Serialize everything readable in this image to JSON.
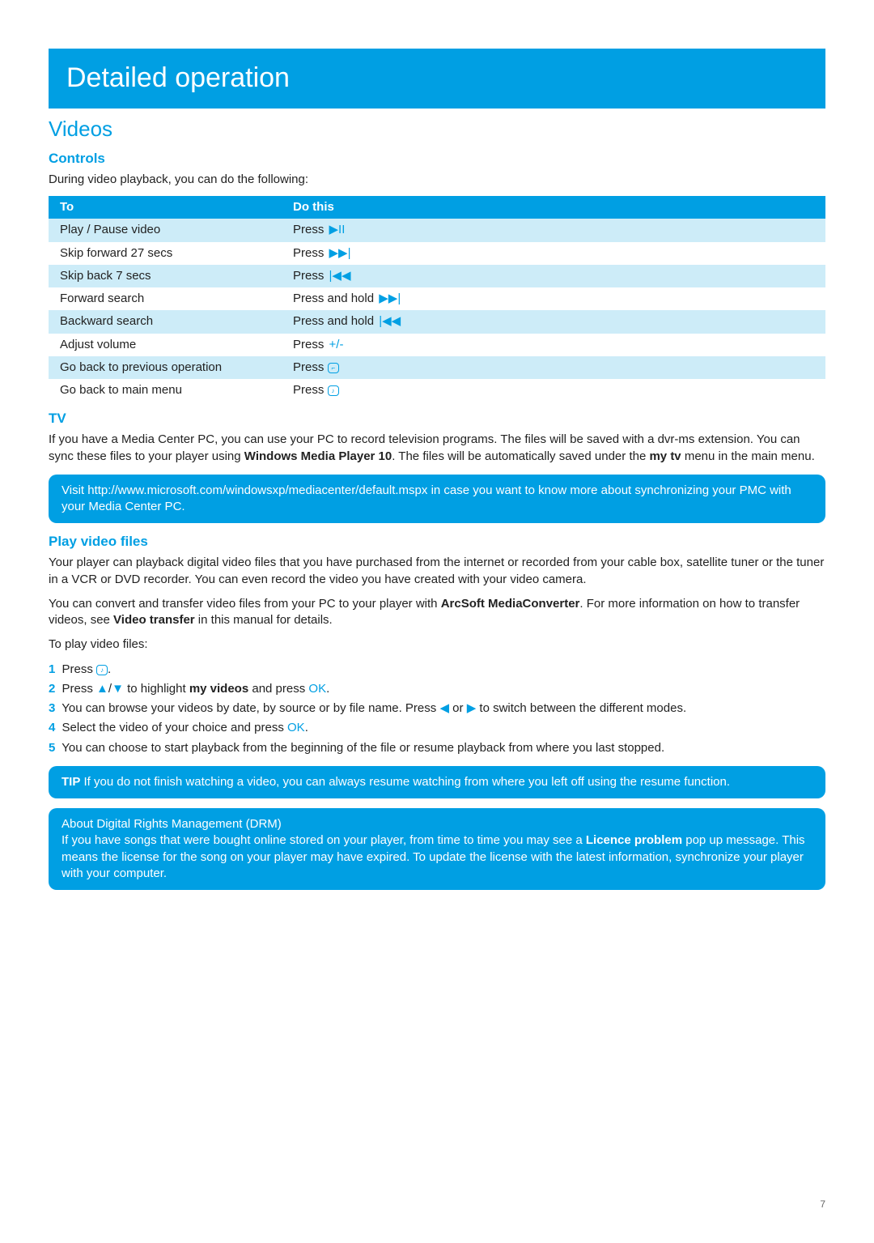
{
  "titleBar": "Detailed operation",
  "section": "Videos",
  "controls": {
    "heading": "Controls",
    "intro": "During video playback, you can do the following:",
    "headerTo": "To",
    "headerDo": "Do this",
    "rows": [
      {
        "to": "Play / Pause video",
        "do": "Press",
        "icon": "▶II"
      },
      {
        "to": "Skip forward 27 secs",
        "do": "Press",
        "icon": "▶▶|"
      },
      {
        "to": "Skip back 7 secs",
        "do": "Press",
        "icon": "|◀◀"
      },
      {
        "to": "Forward search",
        "do": "Press and hold",
        "icon": "▶▶|"
      },
      {
        "to": "Backward search",
        "do": "Press and hold",
        "icon": "|◀◀"
      },
      {
        "to": "Adjust volume",
        "do": "Press ",
        "icon": "+/-"
      },
      {
        "to": "Go back to previous operation",
        "do": "Press",
        "iconBox": "⌐"
      },
      {
        "to": "Go back to main menu",
        "do": "Press ",
        "iconHome": true
      }
    ]
  },
  "tv": {
    "heading": "TV",
    "p1_a": "If you have a Media Center PC, you can use your PC to record television programs. The files will be saved with a dvr-ms extension. You can sync these files to your player using ",
    "p1_b": "Windows Media Player 10",
    "p1_c": ". The files will be automatically saved under the ",
    "p1_d": "my tv",
    "p1_e": " menu in the main menu."
  },
  "tvCallout": "Visit http://www.microsoft.com/windowsxp/mediacenter/default.mspx in case you want to know more about synchronizing your PMC with your Media Center PC.",
  "play": {
    "heading": "Play video files",
    "p1": "Your player can playback digital video files that you have purchased from the internet or recorded from your cable box, satellite tuner or the tuner in a VCR or DVD recorder. You can even record the video you have created with your video camera.",
    "p2_a": "You can convert and transfer video files from your PC to your player with ",
    "p2_b": "ArcSoft MediaConverter",
    "p2_c": ". For more information on how to transfer videos, see ",
    "p2_d": "Video transfer",
    "p2_e": " in this manual for details.",
    "lead": "To play video files:",
    "steps": {
      "n1": "1",
      "s1_a": "Press ",
      "s1_dot": ".",
      "n2": "2",
      "s2_a": "Press ",
      "s2_sep": "/",
      "s2_b": " to highlight ",
      "s2_c": "my videos",
      "s2_d": " and press ",
      "s2_ok": "OK",
      "s2_dot": ".",
      "n3": "3",
      "s3_a": "You can browse your videos by date, by source or by file name. Press ",
      "s3_or": " or ",
      "s3_b": " to switch between the different modes.",
      "n4": "4",
      "s4_a": "Select the video of your choice and press ",
      "s4_ok": "OK",
      "s4_dot": ".",
      "n5": "5",
      "s5_a": "You can choose to start playback from the beginning of the file or resume playback from where you last stopped."
    }
  },
  "tipCallout": {
    "label": "TIP",
    "text": " If you do not finish watching a video, you can always resume watching from where you left off using the resume function."
  },
  "drmCallout": {
    "line1": "About Digital Rights Management (DRM)",
    "line2_a": "If you have songs that were bought online stored on your player, from time to time you may see a ",
    "line2_b": "Licence problem",
    "line2_c": " pop up message. This means the license for the song on your player may have expired. To update the license with the latest information, synchronize your player with your computer."
  },
  "pageNumber": "7"
}
